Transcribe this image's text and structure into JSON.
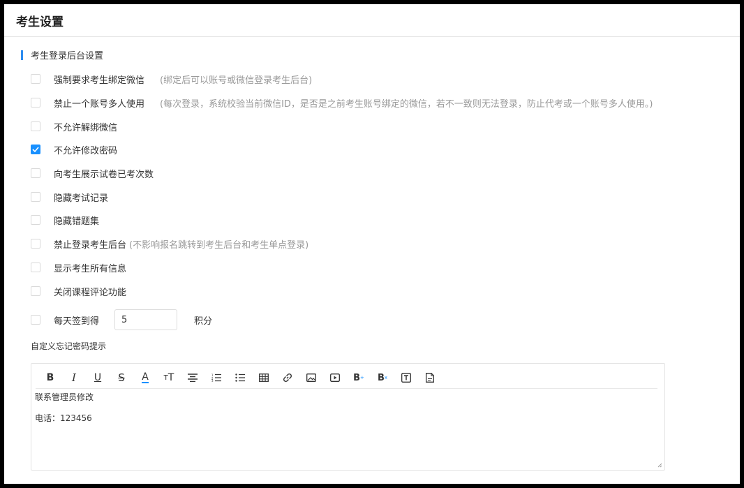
{
  "page": {
    "title": "考生设置"
  },
  "section": {
    "title": "考生登录后台设置"
  },
  "options": [
    {
      "label": "强制要求考生绑定微信",
      "hint": "(绑定后可以账号或微信登录考生后台)",
      "checked": false
    },
    {
      "label": "禁止一个账号多人使用",
      "hint": "(每次登录，系统校验当前微信ID，是否是之前考生账号绑定的微信，若不一致则无法登录，防止代考或一个账号多人使用。)",
      "checked": false
    },
    {
      "label": "不允许解绑微信",
      "hint": "",
      "checked": false
    },
    {
      "label": "不允许修改密码",
      "hint": "",
      "checked": true
    },
    {
      "label": "向考生展示试卷已考次数",
      "hint": "",
      "checked": false
    },
    {
      "label": "隐藏考试记录",
      "hint": "",
      "checked": false
    },
    {
      "label": "隐藏错题集",
      "hint": "",
      "checked": false
    },
    {
      "label": "禁止登录考生后台",
      "hint": "(不影响报名跳转到考生后台和考生单点登录)",
      "checked": false
    },
    {
      "label": "显示考生所有信息",
      "hint": "",
      "checked": false
    },
    {
      "label": "关闭课程评论功能",
      "hint": "",
      "checked": false
    }
  ],
  "checkin": {
    "label": "每天签到得",
    "value": "5",
    "unit": "积分",
    "checked": false
  },
  "forgot_password": {
    "label": "自定义忘记密码提示",
    "lines": [
      "联系管理员修改",
      "电话：123456"
    ]
  },
  "toolbar": {
    "items": [
      "bold-icon",
      "italic-icon",
      "underline-icon",
      "strikethrough-icon",
      "font-color-icon",
      "font-size-icon",
      "align-center-icon",
      "ordered-list-icon",
      "unordered-list-icon",
      "table-icon",
      "link-icon",
      "image-icon",
      "video-icon",
      "superscript-icon",
      "subscript-icon",
      "text-box-icon",
      "file-icon"
    ]
  },
  "colors": {
    "accent": "#1890ff",
    "section_bar": "#2d8cf0",
    "hint": "#999999"
  }
}
